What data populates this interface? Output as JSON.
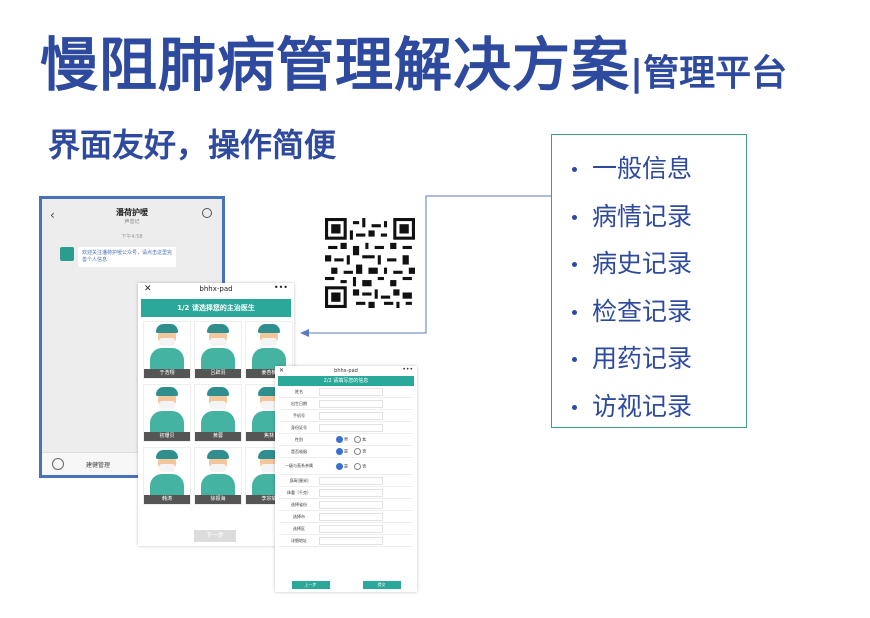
{
  "slide": {
    "title": "慢阻肺病管理解决方案",
    "title_suffix": "|管理平台",
    "subtitle": "界面友好，操作简便"
  },
  "features": [
    "一般信息",
    "病情记录",
    "病史记录",
    "检查记录",
    "用药记录",
    "访视记录"
  ],
  "wechat": {
    "account_name": "潘荷护嗳",
    "account_tag": "声音记",
    "time": "下午4:58",
    "message": "欢迎关注潘荷护嗳公众号，请点击这里完善个人信息",
    "footer_label": "建健管理"
  },
  "doctor_select": {
    "window_title": "bhhx-pad",
    "banner": "1/2 请选择您的主治医生",
    "doctors": [
      "于浩翔",
      "吕辟羽",
      "姜杏楠",
      "初珊贝",
      "黄蓉",
      "焦林",
      "韩涛",
      "徐振海",
      "李宗璐"
    ],
    "next_label": "下一步"
  },
  "form": {
    "window_title": "bhhx-pad",
    "banner": "2/2 请填写您的信息",
    "fields": [
      "姓名",
      "出生日期",
      "手机号",
      "身份证号"
    ],
    "radio_fields": [
      {
        "label": "性别",
        "opt1": "男",
        "opt2": "女"
      },
      {
        "label": "是否吸烟",
        "opt1": "是",
        "opt2": "否"
      },
      {
        "label": "一级与直系亲属",
        "opt1": "是",
        "opt2": "否"
      }
    ],
    "more_fields": [
      "身高(厘米)",
      "体重（千克）",
      "选择省份",
      "选择市",
      "选择区",
      "详细地址"
    ],
    "prev_label": "上一步",
    "submit_label": "提交"
  },
  "colors": {
    "title": "#2e4a9e",
    "teal": "#2aa89a",
    "frame": "#4a72b8",
    "list_border": "#3aa37a"
  }
}
